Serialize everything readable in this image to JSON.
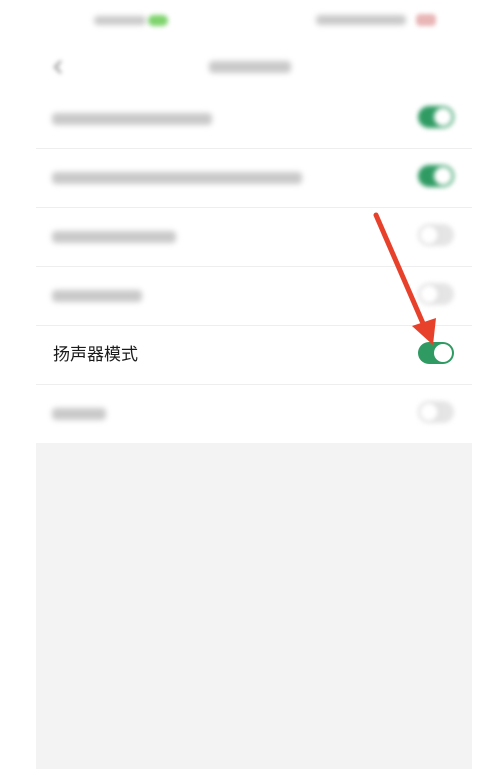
{
  "settings": {
    "items": [
      {
        "label": "",
        "state": "on",
        "blurred": true
      },
      {
        "label": "",
        "state": "on",
        "blurred": true
      },
      {
        "label": "",
        "state": "off",
        "blurred": true
      },
      {
        "label": "",
        "state": "off",
        "blurred": true
      },
      {
        "label": "扬声器模式",
        "state": "on",
        "blurred": false
      },
      {
        "label": "",
        "state": "off",
        "blurred": true
      }
    ]
  },
  "colors": {
    "toggle_on": "#2f9b63",
    "toggle_off": "#e5e5e5",
    "annotation_arrow": "#e8412b",
    "page_background": "#f3f3f3"
  },
  "icons": {
    "back": "chevron-left-icon",
    "annotation": "red-arrow-icon"
  }
}
